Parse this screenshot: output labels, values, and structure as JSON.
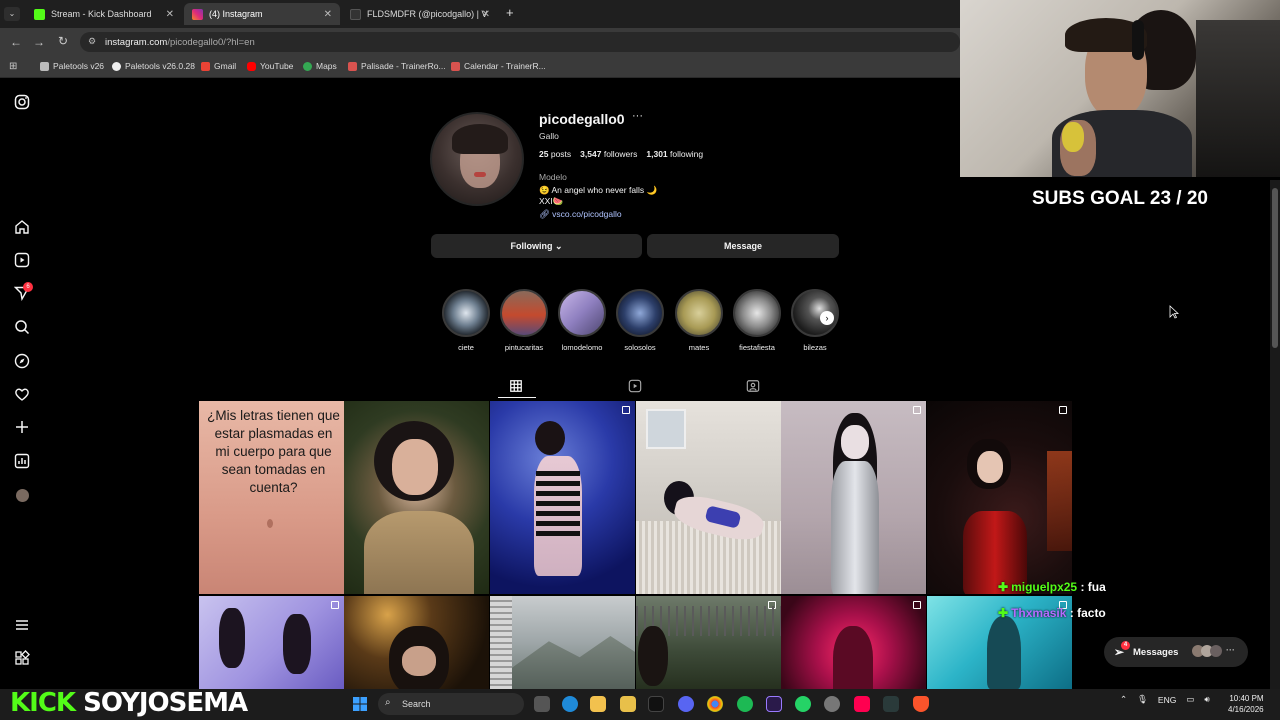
{
  "browser": {
    "tabs": [
      {
        "title": "Stream - Kick Dashboard",
        "color": "#53fc18"
      },
      {
        "title": "(4) Instagram",
        "color": "#c13584"
      },
      {
        "title": "FLDSMDFR (@picodgallo) | VSC",
        "color": "#333333"
      }
    ],
    "new_tab": "+",
    "url_host": "instagram.com",
    "url_path": "/picodegallo0/?hl=en",
    "bookmarks": [
      {
        "label": "Paletools v26",
        "color": "#bbbbbb"
      },
      {
        "label": "Paletools v26.0.28",
        "color": "#eeeeee"
      },
      {
        "label": "Gmail",
        "color": "#ea4335"
      },
      {
        "label": "YouTube",
        "color": "#ff0000"
      },
      {
        "label": "Maps",
        "color": "#34a853"
      },
      {
        "label": "Palisade - TrainerRo...",
        "color": "#d9534f"
      },
      {
        "label": "Calendar - TrainerR...",
        "color": "#d9534f"
      }
    ]
  },
  "nav": {
    "notification_count": "6"
  },
  "profile": {
    "username": "picodegallo0",
    "more": "···",
    "full_name": "Gallo",
    "posts": "25",
    "posts_label": "posts",
    "followers": "3,547",
    "followers_label": "followers",
    "following": "1,301",
    "following_label": "following",
    "category": "Modelo",
    "bio_line1": "😉 An angel who never falls 🌙",
    "bio_line2": "XXI🍉",
    "link": "vsco.co/picodgallo",
    "following_button": "Following ⌄",
    "message_button": "Message"
  },
  "highlights": [
    {
      "label": "ciete"
    },
    {
      "label": "pintucaritas"
    },
    {
      "label": "lomodelomo"
    },
    {
      "label": "solosolos"
    },
    {
      "label": "mates"
    },
    {
      "label": "fiestafiesta"
    },
    {
      "label": "bilezas"
    }
  ],
  "first_post_text": "¿Mis letras tienen que estar plasmadas en mi cuerpo para que sean tomadas en cuenta?",
  "overlay": {
    "subs_goal": "SUBS GOAL 23 / 20",
    "chat": [
      {
        "user": "miguelpx25",
        "text": ": fua",
        "color": "#53fc18"
      },
      {
        "user": "Thxmasik",
        "text": ": facto",
        "color": "#b46bff"
      }
    ],
    "messages_label": "Messages",
    "messages_badge": "4",
    "kick_brand": "KICK",
    "channel": "SOYJOSEMA"
  },
  "taskbar": {
    "search": "Search",
    "lang": "ENG",
    "time": "10:40 PM",
    "date": "4/16/2026"
  }
}
